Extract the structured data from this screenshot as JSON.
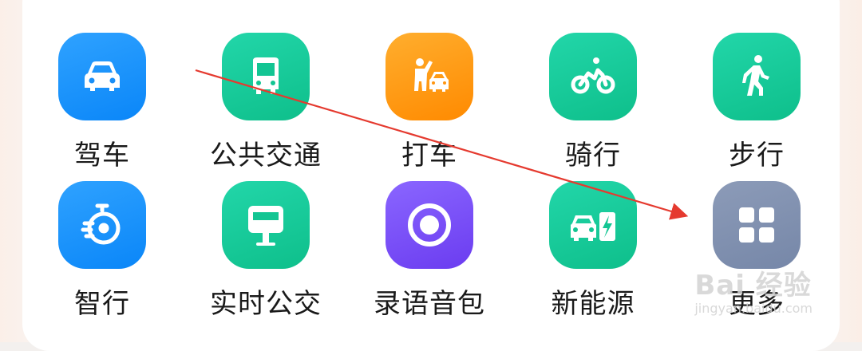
{
  "grid": {
    "row1": [
      {
        "label": "驾车",
        "icon": "car-icon",
        "color": "#1a93fb"
      },
      {
        "label": "公共交通",
        "icon": "bus-icon",
        "color": "#18cc9b"
      },
      {
        "label": "打车",
        "icon": "taxi-hail-icon",
        "color": "#ff9a12"
      },
      {
        "label": "骑行",
        "icon": "bicycle-icon",
        "color": "#18cc9b"
      },
      {
        "label": "步行",
        "icon": "walking-icon",
        "color": "#18cc9b"
      }
    ],
    "row2": [
      {
        "label": "智行",
        "icon": "stopwatch-icon",
        "color": "#1a93fb"
      },
      {
        "label": "实时公交",
        "icon": "bus-stop-sign-icon",
        "color": "#18cc9b"
      },
      {
        "label": "录语音包",
        "icon": "record-icon",
        "color": "#7a52f8"
      },
      {
        "label": "新能源",
        "icon": "ev-charging-icon",
        "color": "#18cc9b"
      },
      {
        "label": "更多",
        "icon": "grid-more-icon",
        "color": "#8292b1"
      }
    ]
  },
  "annotation": {
    "arrow_color": "#e53a2f"
  },
  "watermark": {
    "logo": "Bai 经验",
    "sub": "jingyan.baidu.com"
  }
}
